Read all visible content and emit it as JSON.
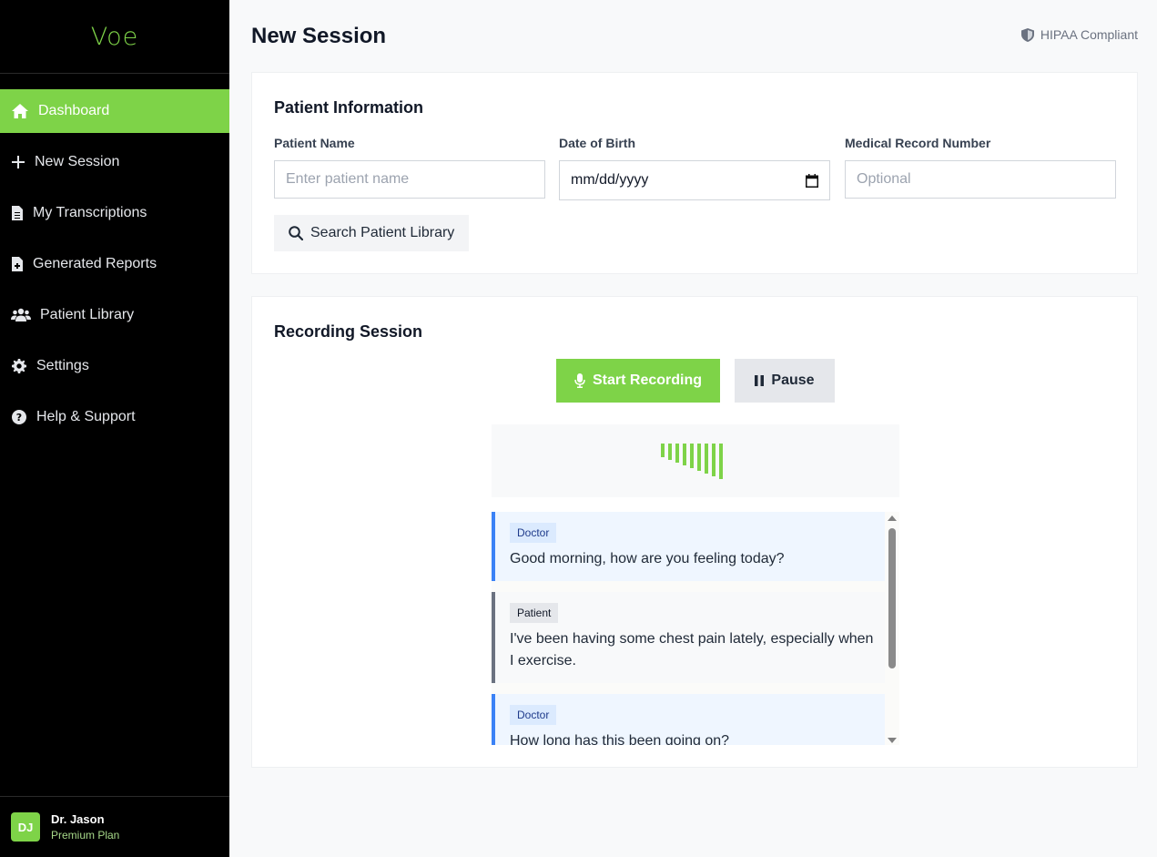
{
  "app": {
    "logo": "Voe"
  },
  "sidebar": {
    "items": [
      {
        "label": "Dashboard",
        "icon": "home-icon",
        "active": true
      },
      {
        "label": "New Session",
        "icon": "plus-icon"
      },
      {
        "label": "My Transcriptions",
        "icon": "file-icon"
      },
      {
        "label": "Generated Reports",
        "icon": "file-medical-icon"
      },
      {
        "label": "Patient Library",
        "icon": "users-icon"
      },
      {
        "label": "Settings",
        "icon": "gear-icon"
      },
      {
        "label": "Help & Support",
        "icon": "question-circle-icon"
      }
    ],
    "user": {
      "initials": "DJ",
      "name": "Dr. Jason",
      "plan": "Premium Plan"
    }
  },
  "header": {
    "title": "New Session",
    "badge": "HIPAA Compliant"
  },
  "patient_info": {
    "title": "Patient Information",
    "name_label": "Patient Name",
    "name_placeholder": "Enter patient name",
    "dob_label": "Date of Birth",
    "dob_value": "mm/dd/yyyy",
    "mrn_label": "Medical Record Number",
    "mrn_placeholder": "Optional",
    "search_button": "Search Patient Library"
  },
  "recording": {
    "title": "Recording Session",
    "start_button": "Start Recording",
    "pause_button": "Pause",
    "waveform_levels": [
      0.38,
      0.46,
      0.54,
      0.62,
      0.69,
      0.77,
      0.85,
      0.92,
      1.0
    ],
    "transcript": [
      {
        "speaker": "Doctor",
        "text": "Good morning, how are you feeling today?"
      },
      {
        "speaker": "Patient",
        "text": "I've been having some chest pain lately, especially when I exercise."
      },
      {
        "speaker": "Doctor",
        "text": "How long has this been going on?"
      }
    ]
  },
  "colors": {
    "accent": "#7ed348",
    "sidebar_bg": "#000000",
    "doctor_border": "#3b82f6",
    "patient_border": "#6b7280"
  }
}
